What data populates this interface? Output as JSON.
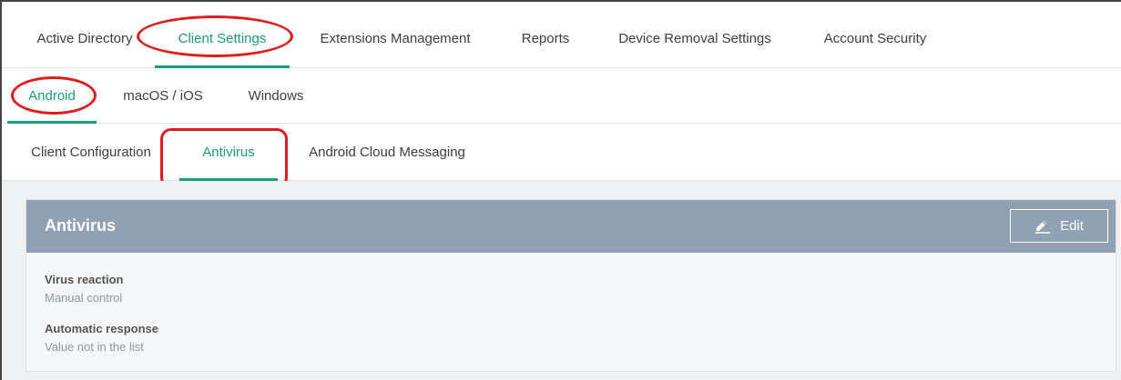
{
  "tabs_level1": [
    {
      "label": "Active Directory",
      "active": false
    },
    {
      "label": "Client Settings",
      "active": true
    },
    {
      "label": "Extensions Management",
      "active": false
    },
    {
      "label": "Reports",
      "active": false
    },
    {
      "label": "Device Removal Settings",
      "active": false
    },
    {
      "label": "Account Security",
      "active": false
    }
  ],
  "tabs_level2": [
    {
      "label": "Android",
      "active": true
    },
    {
      "label": "macOS / iOS",
      "active": false
    },
    {
      "label": "Windows",
      "active": false
    }
  ],
  "tabs_level3": [
    {
      "label": "Client Configuration",
      "active": false
    },
    {
      "label": "Antivirus",
      "active": true
    },
    {
      "label": "Android Cloud Messaging",
      "active": false
    }
  ],
  "panel": {
    "title": "Antivirus",
    "edit_label": "Edit",
    "edit_icon": "pencil-icon",
    "fields": [
      {
        "label": "Virus reaction",
        "value": "Manual control"
      },
      {
        "label": "Automatic response",
        "value": "Value not in the list"
      }
    ]
  },
  "colors": {
    "accent": "#1a9c77",
    "annotation": "#e01d1d",
    "panel_header": "#8fa1b2"
  }
}
